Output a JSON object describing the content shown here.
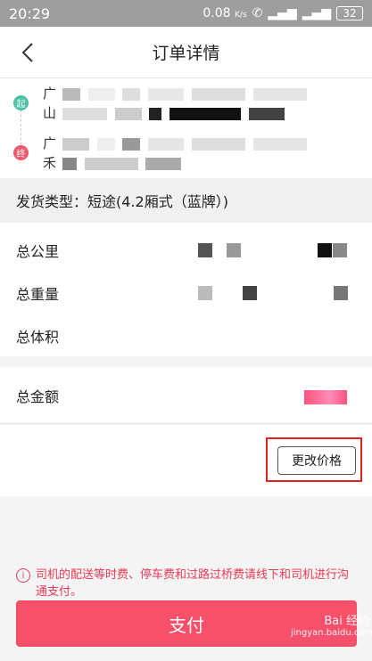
{
  "status_bar": {
    "time": "20:29",
    "speed": "0.08",
    "speed_unit": "K/s",
    "battery": "32"
  },
  "header": {
    "title": "订单详情"
  },
  "route": {
    "start_tag": "起",
    "start_address_visible": "广",
    "start_address_line2": "山",
    "end_tag": "终",
    "end_address_visible": "广",
    "end_address_line2": "禾"
  },
  "order": {
    "shipping_type": "发货类型：短途(4.2厢式（蓝牌）)"
  },
  "info": {
    "distance_label": "总公里",
    "weight_label": "总重量",
    "volume_label": "总体积"
  },
  "amount": {
    "label": "总金额"
  },
  "actions": {
    "change_price": "更改价格",
    "pay": "支付"
  },
  "notice": {
    "text": "司机的配送等时费、停车费和过路过桥费请线下和司机进行沟通支付。"
  },
  "watermark": {
    "text": "Bai 经验",
    "url": "jingyan.baidu.com"
  }
}
